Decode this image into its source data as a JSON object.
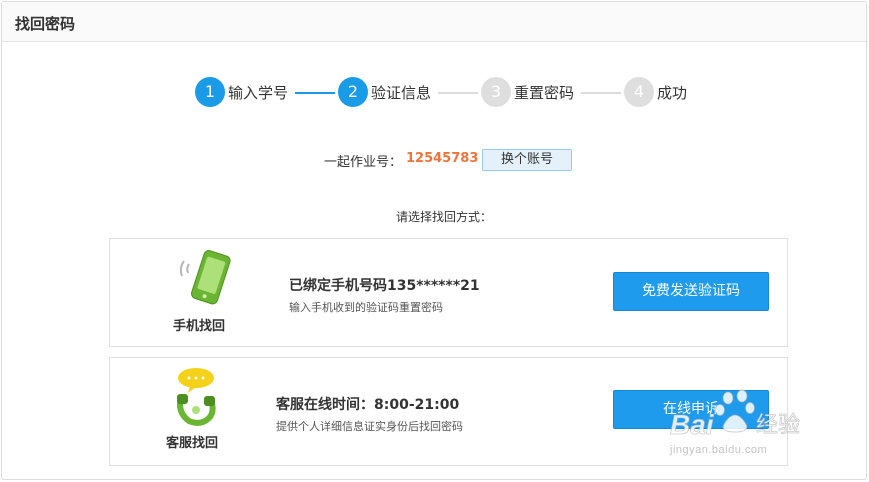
{
  "page": {
    "title": "找回密码"
  },
  "steps": [
    {
      "num": "1",
      "label": "输入学号"
    },
    {
      "num": "2",
      "label": "验证信息"
    },
    {
      "num": "3",
      "label": "重置密码"
    },
    {
      "num": "4",
      "label": "成功"
    }
  ],
  "account": {
    "label": "一起作业号：",
    "number": "12545783",
    "switch_label": "换个账号"
  },
  "prompt": "请选择找回方式：",
  "methods": {
    "phone": {
      "icon_label": "手机找回",
      "title": "已绑定手机号码135******21",
      "desc": "输入手机收到的验证码重置密码",
      "button": "免费发送验证码"
    },
    "service": {
      "icon_label": "客服找回",
      "title": "客服在线时间：8:00-21:00",
      "desc": "提供个人详细信息证实身份后找回密码",
      "button": "在线申诉"
    }
  },
  "watermark": {
    "logo": "Baidu经验",
    "url": "jingyan.baidu.com"
  },
  "colors": {
    "accent": "#1a9be8",
    "account_number": "#f0743a",
    "inactive": "#dedede"
  }
}
